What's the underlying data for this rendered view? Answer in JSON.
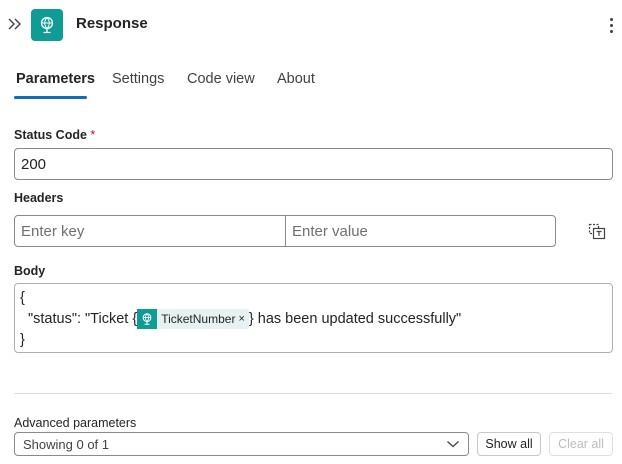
{
  "header": {
    "title": "Response",
    "collapse_icon": "chevron-double-right-icon",
    "app_icon": "globe-person-icon",
    "more_icon": "more-vertical-icon",
    "accent_color": "#0e9c94"
  },
  "tabs": [
    {
      "label": "Parameters",
      "active": true
    },
    {
      "label": "Settings",
      "active": false
    },
    {
      "label": "Code view",
      "active": false
    },
    {
      "label": "About",
      "active": false
    }
  ],
  "status_code": {
    "label": "Status Code",
    "required_mark": "*",
    "value": "200"
  },
  "headers": {
    "label": "Headers",
    "key_placeholder": "Enter key",
    "value_placeholder": "Enter value",
    "switch_icon": "text-mode-switch-icon"
  },
  "body": {
    "label": "Body",
    "line1": "{",
    "line2_prefix": "\"status\": \"Ticket {",
    "token_label": "TicketNumber",
    "token_close": "×",
    "line2_suffix": "} has been updated successfully\"",
    "line3": "}"
  },
  "advanced": {
    "label": "Advanced parameters",
    "dropdown_value": "Showing 0 of 1",
    "show_all": "Show all",
    "clear_all": "Clear all"
  }
}
